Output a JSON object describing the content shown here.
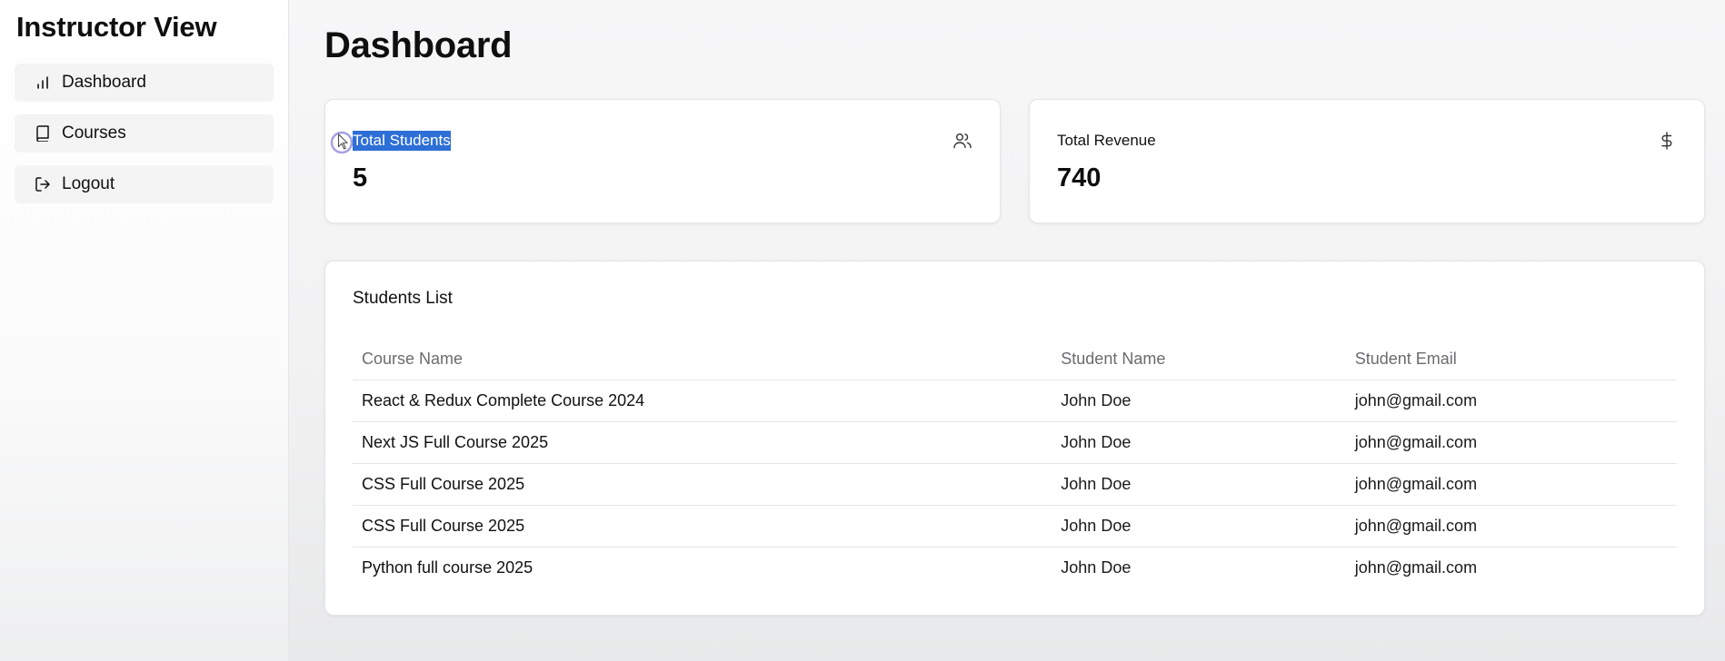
{
  "sidebar": {
    "title": "Instructor View",
    "items": [
      {
        "label": "Dashboard",
        "icon": "bar-chart-icon"
      },
      {
        "label": "Courses",
        "icon": "book-icon"
      },
      {
        "label": "Logout",
        "icon": "logout-icon"
      }
    ]
  },
  "main": {
    "title": "Dashboard",
    "stats": [
      {
        "label": "Total Students",
        "value": "5",
        "icon": "users-icon",
        "text_selected": true
      },
      {
        "label": "Total Revenue",
        "value": "740",
        "icon": "dollar-icon"
      }
    ],
    "students_list": {
      "title": "Students List",
      "columns": [
        "Course Name",
        "Student Name",
        "Student Email"
      ],
      "rows": [
        {
          "course": "React & Redux Complete Course 2024",
          "name": "John Doe",
          "email": "john@gmail.com"
        },
        {
          "course": "Next JS Full Course 2025",
          "name": "John Doe",
          "email": "john@gmail.com"
        },
        {
          "course": "CSS Full Course 2025",
          "name": "John Doe",
          "email": "john@gmail.com"
        },
        {
          "course": "CSS Full Course 2025",
          "name": "John Doe",
          "email": "john@gmail.com"
        },
        {
          "course": "Python full course 2025",
          "name": "John Doe",
          "email": "john@gmail.com"
        }
      ]
    }
  },
  "colors": {
    "selection": "#2d6fd6",
    "nav_bg": "#f4f4f5",
    "muted_text": "#6b6b70"
  }
}
